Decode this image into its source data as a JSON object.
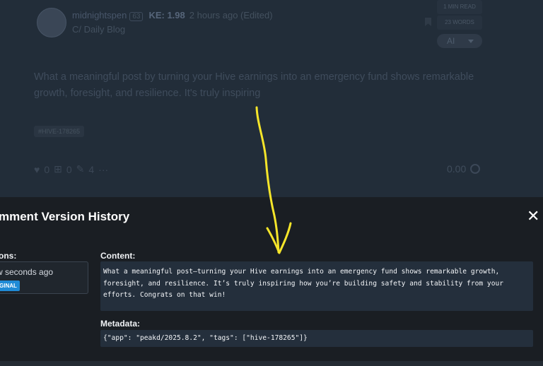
{
  "post": {
    "author": "midnightspen",
    "reputation": "63",
    "ke": "KE: 1.98",
    "time": "2 hours ago (Edited)",
    "community": "C/ Daily Blog",
    "read_time": "1 MIN READ",
    "words": "23 WORDS",
    "ai_label": "AI",
    "body": "What a meaningful post by turning your Hive earnings into an emergency fund shows remarkable growth, foresight, and resilience. It's truly inspiring",
    "tag": "#HIVE-178265",
    "votes": "0",
    "reblogs": "0",
    "comments": "4",
    "more": "···",
    "payout": "0.00"
  },
  "modal": {
    "title": "mment Version History",
    "close_label": "✕",
    "versions_label": "ons:",
    "version_time": "w seconds ago",
    "version_badge": "GINAL",
    "content_label": "Content:",
    "content_text": "What a meaningful post—turning your Hive earnings into an emergency fund shows remarkable growth, foresight, and resilience. It’s truly inspiring how you’re building safety and stability from your efforts. Congrats on that win!",
    "metadata_label": "Metadata:",
    "metadata_text": "{\"app\": \"peakd/2025.8.2\", \"tags\": [\"hive-178265\"]}"
  },
  "annotation": {
    "arrow_color": "#f5e52a"
  }
}
